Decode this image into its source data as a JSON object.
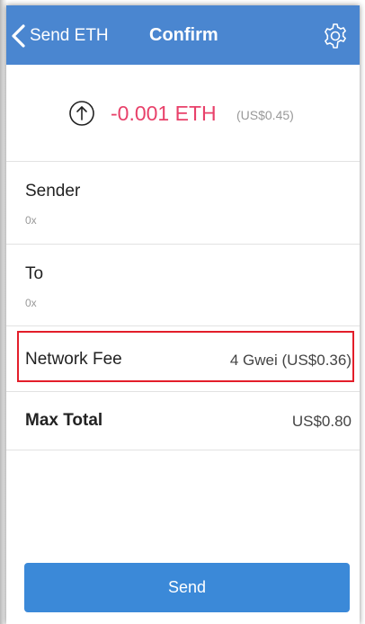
{
  "header": {
    "back_label": "Send ETH",
    "title": "Confirm"
  },
  "transaction": {
    "amount": "-0.001 ETH",
    "amount_usd": "(US$0.45)"
  },
  "sender": {
    "label": "Sender",
    "address": "0x"
  },
  "recipient": {
    "label": "To",
    "address": "0x"
  },
  "network_fee": {
    "label": "Network Fee",
    "value": "4 Gwei (US$0.36)"
  },
  "max_total": {
    "label": "Max Total",
    "value": "US$0.80"
  },
  "actions": {
    "send_label": "Send"
  },
  "colors": {
    "header_bg": "#4a86d0",
    "amount": "#e8416a",
    "highlight": "#e31e2a",
    "button": "#3b89d8"
  }
}
